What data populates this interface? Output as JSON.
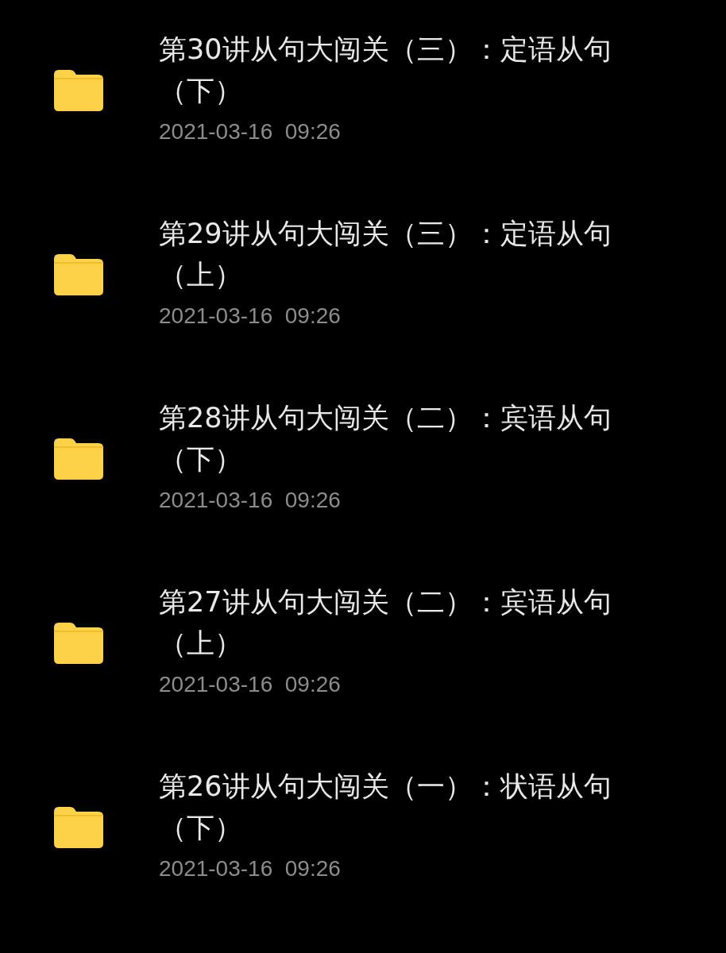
{
  "folders": [
    {
      "name": "第30讲从句大闯关（三）：定语从句（下）",
      "modified": "2021-03-16  09:26"
    },
    {
      "name": "第29讲从句大闯关（三）：定语从句（上）",
      "modified": "2021-03-16  09:26"
    },
    {
      "name": "第28讲从句大闯关（二）：宾语从句（下）",
      "modified": "2021-03-16  09:26"
    },
    {
      "name": "第27讲从句大闯关（二）：宾语从句（上）",
      "modified": "2021-03-16  09:26"
    },
    {
      "name": "第26讲从句大闯关（一）：状语从句（下）",
      "modified": "2021-03-16  09:26"
    }
  ]
}
